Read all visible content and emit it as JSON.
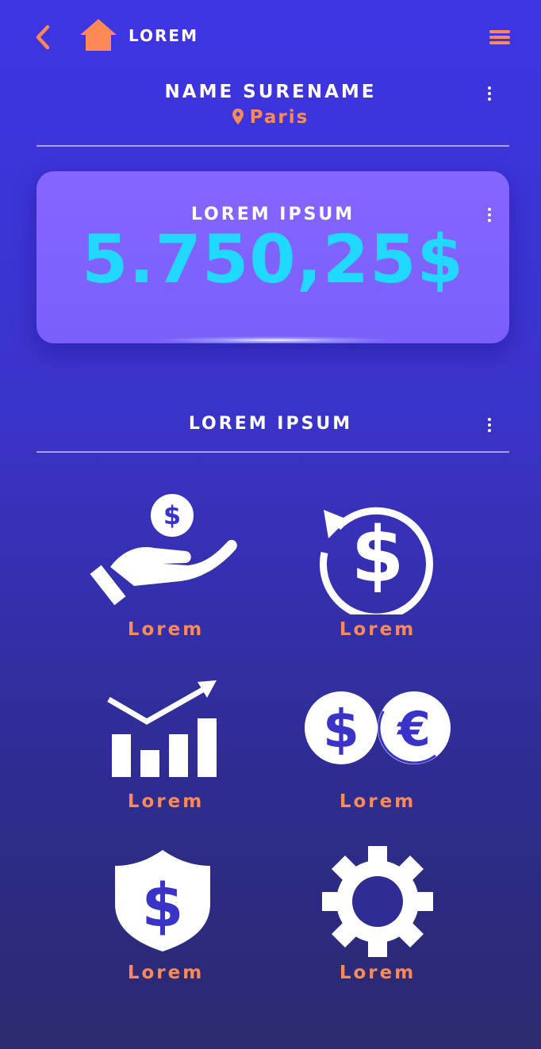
{
  "header": {
    "title": "LOREM",
    "back_icon": "chevron-left-icon",
    "home_icon": "home-icon",
    "menu_icon": "hamburger-menu-icon"
  },
  "profile": {
    "name": "NAME SURENAME",
    "location": "Paris"
  },
  "balance_card": {
    "title": "LOREM IPSUM",
    "amount": "5.750,25$"
  },
  "section": {
    "title": "LOREM IPSUM"
  },
  "tiles": [
    {
      "label": "Lorem",
      "icon": "hand-coin-icon"
    },
    {
      "label": "Lorem",
      "icon": "refund-dollar-icon"
    },
    {
      "label": "Lorem",
      "icon": "growth-chart-icon"
    },
    {
      "label": "Lorem",
      "icon": "dollar-euro-exchange-icon"
    },
    {
      "label": "Lorem",
      "icon": "shield-dollar-icon"
    },
    {
      "label": "Lorem",
      "icon": "settings-gear-icon"
    }
  ],
  "colors": {
    "accent": "#ff8a55",
    "amount": "#21d9ff",
    "card": "#7a5ff8",
    "background_top": "#3f35e4",
    "background_bottom": "#2a2a6e"
  }
}
